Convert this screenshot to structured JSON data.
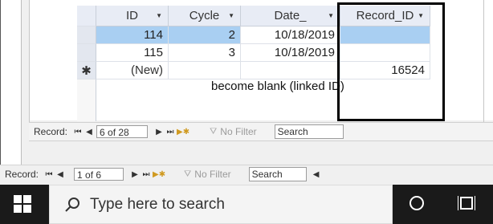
{
  "datasheet": {
    "columns": [
      "ID",
      "Cycle",
      "Date_",
      "Record_ID"
    ],
    "rows": [
      {
        "id": "114",
        "cycle": "2",
        "date": "10/18/2019",
        "record_id": ""
      },
      {
        "id": "115",
        "cycle": "3",
        "date": "10/18/2019",
        "record_id": ""
      }
    ],
    "new_row": {
      "marker": "✱",
      "id": "(New)",
      "record_id": "16524"
    }
  },
  "annotation": "become blank (linked ID)",
  "subform_nav": {
    "label": "Record:",
    "current": "6 of 28",
    "filter": "No Filter",
    "search": "Search"
  },
  "main_nav": {
    "label": "Record:",
    "current": "1 of 6",
    "filter": "No Filter",
    "search": "Search"
  },
  "taskbar": {
    "search_placeholder": "Type here to search"
  },
  "colors": {
    "selected_row": "#a9cff2",
    "header_bg": "#e8ecf5",
    "taskbar": "#1a1a1a"
  }
}
